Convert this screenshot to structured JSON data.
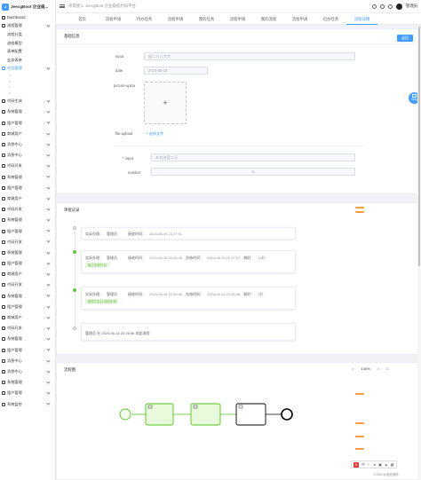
{
  "app": {
    "name": "JeecgBoot 企业级..."
  },
  "header": {
    "breadcrumb": "项目接入  JeecgBoot 企业级低代码平台",
    "user": "管理员"
  },
  "sidebar": {
    "top_items": [
      {
        "label": "Dashboard",
        "icon": "dashboard-icon",
        "arrow": false,
        "sub": false
      },
      {
        "label": "流程管理",
        "icon": "flow-icon",
        "arrow": true,
        "sub": false
      },
      {
        "label": "流程分类",
        "icon": "",
        "arrow": false,
        "sub": true
      },
      {
        "label": "流程模型",
        "icon": "",
        "arrow": false,
        "sub": true
      },
      {
        "label": "表单配置",
        "icon": "",
        "arrow": false,
        "sub": true
      },
      {
        "label": "业务表单",
        "icon": "",
        "arrow": false,
        "sub": true
      },
      {
        "label": "任务管理",
        "icon": "task-icon",
        "arrow": true,
        "sub": false,
        "active": true
      }
    ],
    "bottom_items": [
      {
        "label": "代码生成",
        "icon": "code-icon"
      },
      {
        "label": "系统管理",
        "icon": "gear-icon"
      },
      {
        "label": "租户管理",
        "icon": "tenant-icon"
      },
      {
        "label": "商城用户",
        "icon": "user-icon"
      },
      {
        "label": "消息中心",
        "icon": "message-icon"
      },
      {
        "label": "消息中心",
        "icon": "message-icon"
      },
      {
        "label": "代码开发",
        "icon": "code-icon"
      },
      {
        "label": "系统管理",
        "icon": "gear-icon"
      },
      {
        "label": "租户管理",
        "icon": "tenant-icon"
      },
      {
        "label": "商城用户",
        "icon": "user-icon"
      },
      {
        "label": "代码开发",
        "icon": "code-icon"
      },
      {
        "label": "系统管理",
        "icon": "gear-icon"
      },
      {
        "label": "租户管理",
        "icon": "tenant-icon"
      },
      {
        "label": "代码开发",
        "icon": "code-icon"
      },
      {
        "label": "系统管理",
        "icon": "gear-icon"
      },
      {
        "label": "租户管理",
        "icon": "tenant-icon"
      },
      {
        "label": "商城用户",
        "icon": "user-icon"
      },
      {
        "label": "代码开发",
        "icon": "code-icon"
      },
      {
        "label": "系统管理",
        "icon": "gear-icon"
      },
      {
        "label": "租户管理",
        "icon": "tenant-icon"
      },
      {
        "label": "商城用户",
        "icon": "user-icon"
      },
      {
        "label": "代码开发",
        "icon": "code-icon"
      },
      {
        "label": "系统管理",
        "icon": "gear-icon"
      },
      {
        "label": "租户管理",
        "icon": "tenant-icon"
      },
      {
        "label": "消息中心",
        "icon": "message-icon"
      },
      {
        "label": "消息中心",
        "icon": "message-icon"
      },
      {
        "label": "系统管理",
        "icon": "gear-icon"
      },
      {
        "label": "租户管理",
        "icon": "tenant-icon"
      },
      {
        "label": "系统监控",
        "icon": "monitor-icon"
      }
    ]
  },
  "tabs": [
    "首页",
    "流程申请",
    "待办任务",
    "流程申请",
    "我的任务",
    "流程申请",
    "我的流程",
    "流程申请",
    "已办任务",
    "流程详情"
  ],
  "active_tab": 9,
  "basic": {
    "title": "基础信息",
    "button": "返回",
    "fields": {
      "input_label": "input",
      "input_value": "留二八八大大",
      "date_label": "date",
      "date_value": "2024-06-15",
      "picture_label": "picture-uploa",
      "file_label": "file-upload",
      "file_link": "+ 选择文件",
      "input2_label": "* input",
      "input2_value": "乡村进度二万",
      "number_label": "number",
      "number_value": "N"
    }
  },
  "approval": {
    "title": "审批记录",
    "records": [
      {
        "handler_label": "实际办理：",
        "handler": "管理员",
        "recv_label": "接收时间：",
        "recv": "2024-06-16 22:27:01"
      },
      {
        "handler_label": "实际办理：",
        "handler": "管理员",
        "recv_label": "接收时间：",
        "recv": "2024-06-16 22:26:46",
        "done_label": "办结时间：",
        "done": "2024-06-16 22:27:07",
        "cost_label": "耗时：",
        "cost": "14秒",
        "tag": "通过流程任务"
      },
      {
        "handler_label": "实际办理：",
        "handler": "管理员",
        "recv_label": "接收时间：",
        "recv": "2024-06-16 22:26:46",
        "done_label": "办结时间：",
        "done": "2024-06-16 22:26:46",
        "cost_label": "耗时：",
        "cost": "0秒",
        "tag": "管理员发起流程申请"
      },
      {
        "text": "管理员 在 2024-06-16 22:26:46 发起流程"
      }
    ]
  },
  "diagram": {
    "title": "流程图",
    "zoom": "100%"
  },
  "help": "help",
  "ime": {
    "letter": "S",
    "lang": "中"
  },
  "footer": "CSDN @若依源码"
}
